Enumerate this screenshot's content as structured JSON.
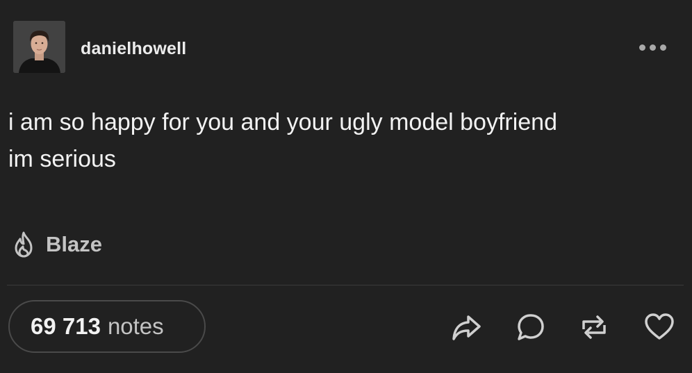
{
  "post": {
    "author": {
      "username": "danielhowell",
      "avatar_icon": "avatar-photo"
    },
    "menu_icon": "more-options-icon",
    "body_lines": [
      "i am so happy for you and your ugly model boyfriend",
      "im serious"
    ],
    "blaze": {
      "icon": "flame-icon",
      "label": "Blaze"
    },
    "footer": {
      "notes_count": "69 713",
      "notes_label": "notes",
      "actions": [
        "share-icon",
        "reply-icon",
        "reblog-icon",
        "like-icon"
      ]
    }
  },
  "colors": {
    "background": "#212121",
    "text": "#f2f2f2",
    "muted": "#c4c4c4",
    "icon": "#d0d0d0"
  }
}
